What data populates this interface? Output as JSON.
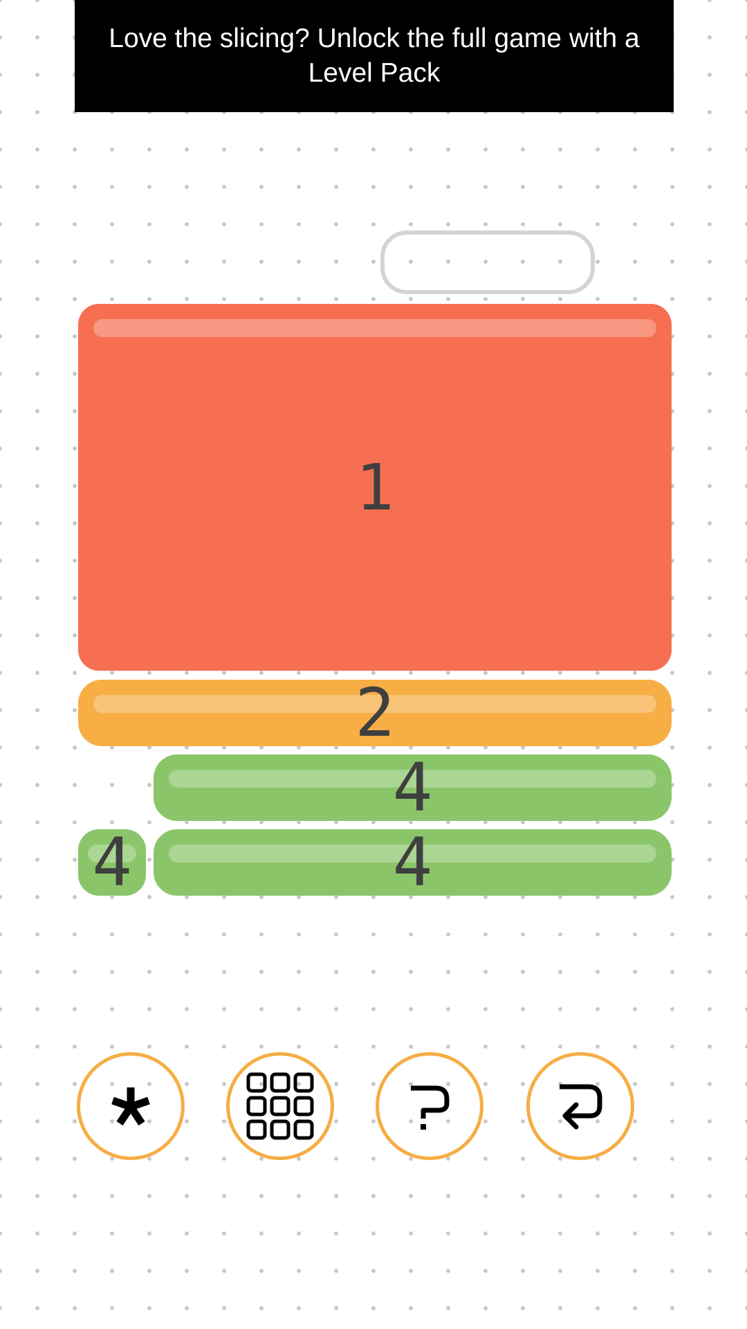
{
  "banner": {
    "text": "Love the slicing? Unlock the full game with a Level Pack"
  },
  "blocks": [
    {
      "label": "1",
      "color": "#f66f53"
    },
    {
      "label": "2",
      "color": "#f6ae45"
    },
    {
      "label": "4",
      "color": "#8bc56a"
    },
    {
      "label": "4",
      "color": "#8bc56a"
    },
    {
      "label": "4",
      "color": "#8bc56a"
    }
  ],
  "controls": [
    {
      "icon": "asterisk-icon"
    },
    {
      "icon": "level-grid-icon"
    },
    {
      "icon": "help-question-icon"
    },
    {
      "icon": "undo-return-icon"
    }
  ],
  "colors": {
    "button_ring": "#f6ad45",
    "banner_bg": "#000000",
    "slot_outline": "#d4d4d4"
  }
}
